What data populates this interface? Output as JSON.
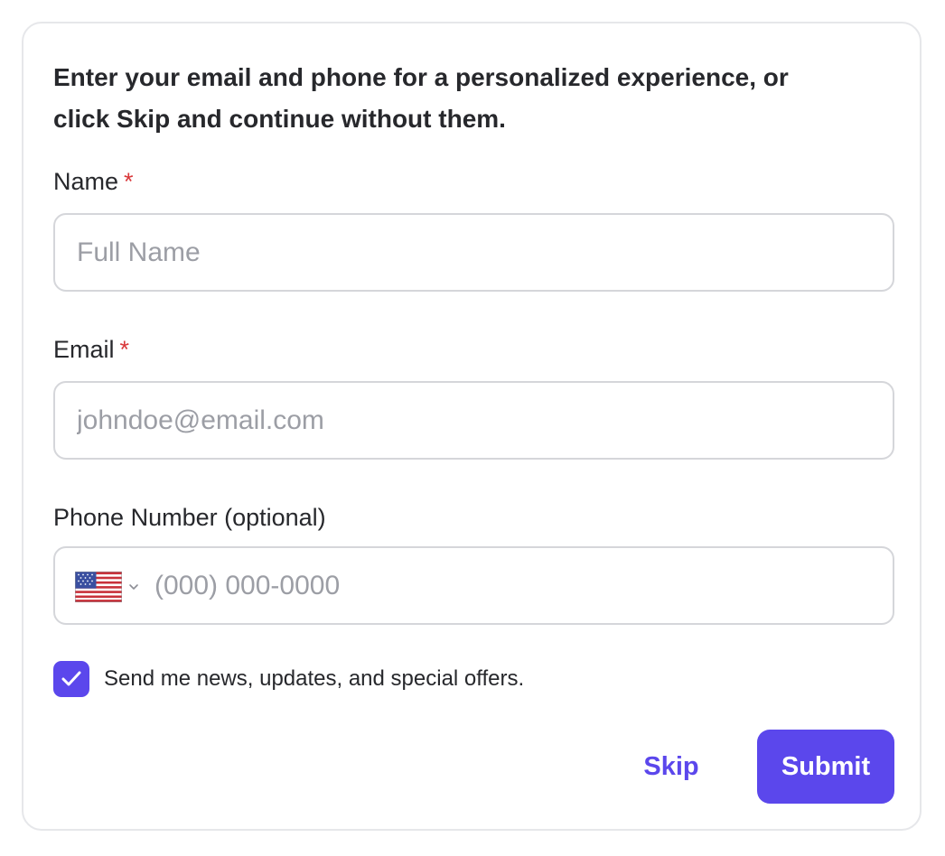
{
  "intro": {
    "line1": "Enter your email and phone for a personalized experience, or",
    "line2": "click Skip and continue without them."
  },
  "fields": {
    "name": {
      "label": "Name",
      "required_mark": "*",
      "placeholder": "Full Name",
      "value": ""
    },
    "email": {
      "label": "Email",
      "required_mark": "*",
      "placeholder": "johndoe@email.com",
      "value": ""
    },
    "phone": {
      "label": "Phone Number (optional)",
      "country_icon": "us-flag-icon",
      "placeholder": "(000) 000-0000",
      "value": ""
    }
  },
  "consent": {
    "checked": true,
    "label": "Send me news, updates, and special offers."
  },
  "actions": {
    "skip_label": "Skip",
    "submit_label": "Submit"
  },
  "colors": {
    "accent": "#5b47ec",
    "required": "#d9383a",
    "border": "#d5d6da",
    "placeholder": "#9c9ea5",
    "text": "#27282c"
  }
}
